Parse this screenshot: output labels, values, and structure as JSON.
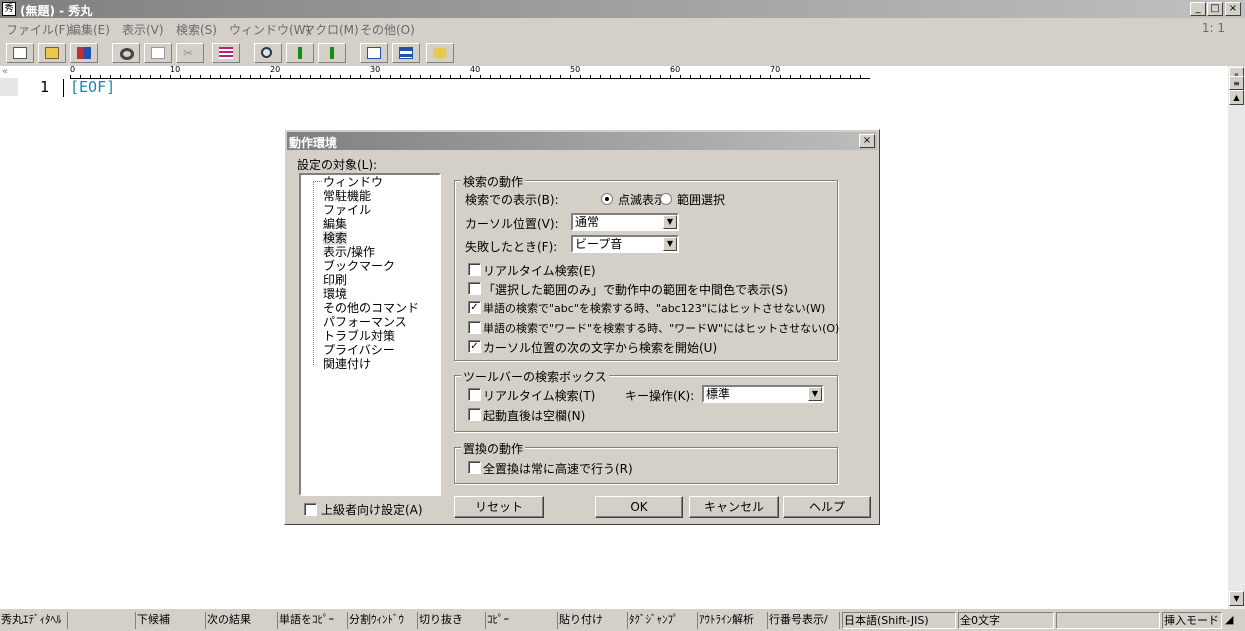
{
  "window": {
    "title": "(無題) - 秀丸",
    "app_icon": "editor-icon",
    "min": "_",
    "max": "□",
    "close": "×"
  },
  "menu": {
    "items": [
      "ファイル(F)",
      "編集(E)",
      "表示(V)",
      "検索(S)",
      "ウィンドウ(W)",
      "マクロ(M)",
      "その他(O)"
    ],
    "position": "1: 1"
  },
  "toolbar": {
    "icons": [
      "new-file-icon",
      "open-folder-icon",
      "save-icon",
      "undo-icon",
      "copy-icon",
      "cut-icon",
      "paste-icon",
      "search-icon",
      "search-down-icon",
      "search-up-icon",
      "grep-icon",
      "window-split-icon",
      "help-icon"
    ]
  },
  "editor": {
    "line_number": "1",
    "eof": "[EOF]",
    "gutter_mark": "«",
    "ruler": [
      "0",
      "10",
      "20",
      "30",
      "40",
      "50",
      "60",
      "70"
    ]
  },
  "dialog": {
    "title": "動作環境",
    "target_label": "設定の対象(L):",
    "tree": [
      "ウィンドウ",
      "常駐機能",
      "ファイル",
      "編集",
      "検索",
      "表示/操作",
      "ブックマーク",
      "印刷",
      "環境",
      "その他のコマンド",
      "パフォーマンス",
      "トラブル対策",
      "プライバシー",
      "関連付け"
    ],
    "selected_index": 4,
    "search_group": {
      "title": "検索の動作",
      "display_label": "検索での表示(B):",
      "radio1": "点滅表示",
      "radio2": "範囲選択",
      "cursor_label": "カーソル位置(V):",
      "cursor_value": "通常",
      "fail_label": "失敗したとき(F):",
      "fail_value": "ビープ音",
      "checks": [
        {
          "label": "リアルタイム検索(E)",
          "checked": false
        },
        {
          "label": "「選択した範囲のみ」で動作中の範囲を中間色で表示(S)",
          "checked": false
        },
        {
          "label": "単語の検索で\"abc\"を検索する時、\"abc123\"にはヒットさせない(W)",
          "checked": true
        },
        {
          "label": "単語の検索で\"ワード\"を検索する時、\"ワードW\"にはヒットさせない(O)",
          "checked": false
        },
        {
          "label": "カーソル位置の次の文字から検索を開始(U)",
          "checked": true
        }
      ]
    },
    "toolbar_group": {
      "title": "ツールバーの検索ボックス",
      "realtime": "リアルタイム検索(T)",
      "key_label": "キー操作(K):",
      "key_value": "標準",
      "startup": "起動直後は空欄(N)"
    },
    "replace_group": {
      "title": "置換の動作",
      "all_fast": "全置換は常に高速で行う(R)"
    },
    "advanced": "上級者向け設定(A)",
    "reset": "リセット",
    "ok": "OK",
    "cancel": "キャンセル",
    "help": "ヘルプ",
    "close": "×"
  },
  "statusbar": {
    "items": [
      "秀丸ｴﾃﾞｨﾀﾍﾙ",
      "",
      "下候補",
      "次の結果",
      "単語をｺﾋﾟｰ",
      "分割ｳｨﾝﾄﾞｳ",
      "切り抜き",
      "ｺﾋﾟｰ",
      "貼り付け",
      "ﾀｸﾞｼﾞｬﾝﾌﾟ",
      "ｱｳﾄﾗｲﾝ解析",
      "行番号表示/",
      "日本語(Shift-JIS)",
      "全0文字",
      "",
      "挿入モード"
    ]
  }
}
